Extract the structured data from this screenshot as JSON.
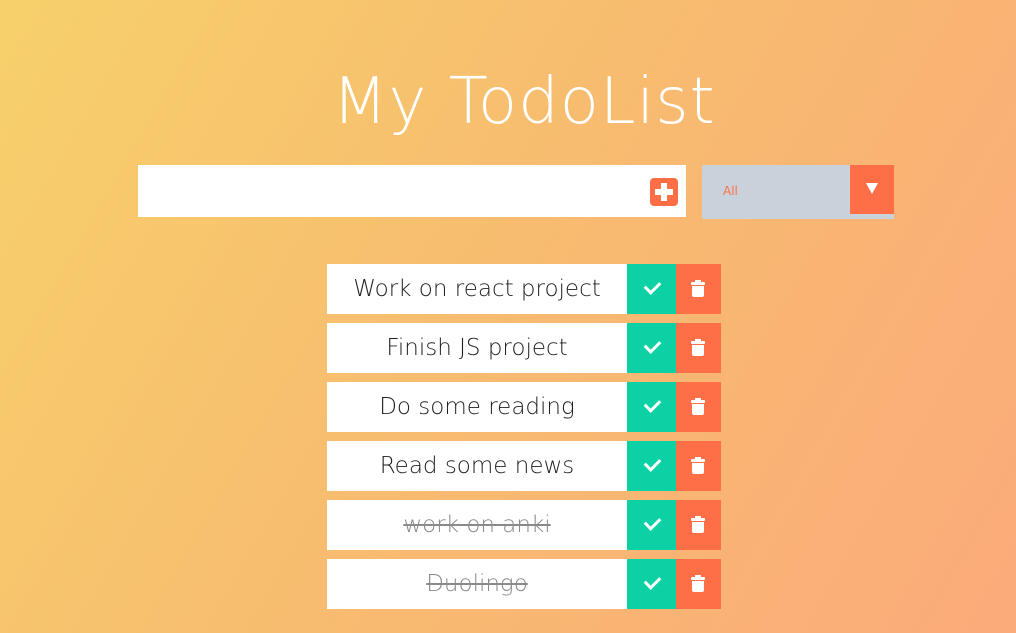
{
  "app": {
    "title": "My TodoList"
  },
  "input": {
    "value": "",
    "placeholder": ""
  },
  "add_button": {
    "icon": "plus-square-icon"
  },
  "filter": {
    "selected": "All"
  },
  "todos": [
    {
      "text": "Work on react project",
      "completed": false
    },
    {
      "text": "Finish JS project",
      "completed": false
    },
    {
      "text": "Do some reading",
      "completed": false
    },
    {
      "text": "Read some news",
      "completed": false
    },
    {
      "text": "work on anki",
      "completed": true
    },
    {
      "text": "Duolingo",
      "completed": true
    }
  ],
  "colors": {
    "accent": "#ff6f47",
    "complete": "#0bd1a4",
    "select_bg": "#c9d2db",
    "gradient_start": "#f7d06b",
    "gradient_end": "#fbaa7a"
  }
}
